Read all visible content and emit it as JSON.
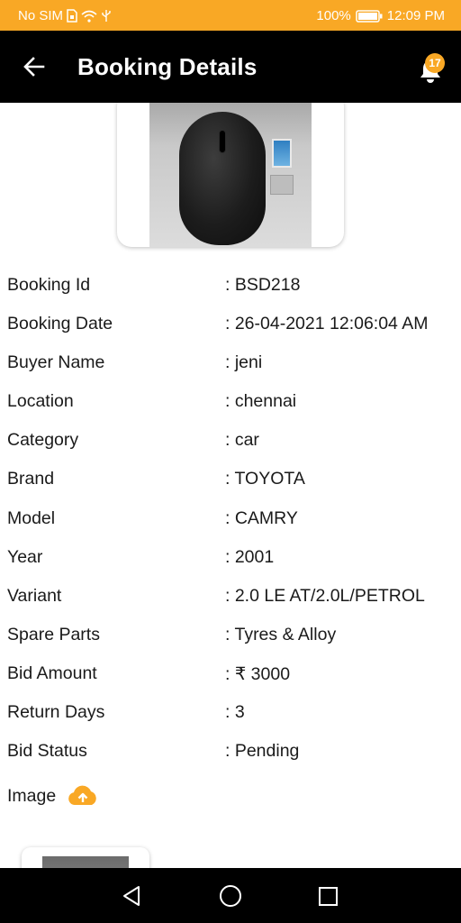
{
  "status_bar": {
    "carrier": "No SIM",
    "battery": "100%",
    "time": "12:09 PM"
  },
  "app_bar": {
    "title": "Booking Details",
    "notification_count": "17"
  },
  "details": [
    {
      "label": "Booking Id",
      "value": ": BSD218"
    },
    {
      "label": "Booking Date",
      "value": ": 26-04-2021 12:06:04 AM"
    },
    {
      "label": "Buyer Name",
      "value": ": jeni"
    },
    {
      "label": "Location",
      "value": ": chennai"
    },
    {
      "label": "Category",
      "value": ": car"
    },
    {
      "label": "Brand",
      "value": ": TOYOTA"
    },
    {
      "label": "Model",
      "value": ": CAMRY"
    },
    {
      "label": "Year",
      "value": ": 2001"
    },
    {
      "label": "Variant",
      "value": ": 2.0 LE AT/2.0L/PETROL"
    },
    {
      "label": "Spare Parts",
      "value": ": Tyres & Alloy"
    },
    {
      "label": "Bid Amount",
      "value": ": ₹ 3000"
    },
    {
      "label": "Return Days",
      "value": ": 3"
    },
    {
      "label": "Bid Status",
      "value": ": Pending"
    }
  ],
  "image_section": {
    "label": "Image",
    "upload_icon": "cloud-upload-icon"
  },
  "icons": {
    "back": "arrow-left-icon",
    "bell": "bell-icon",
    "nav_back": "triangle-back-icon",
    "nav_home": "circle-home-icon",
    "nav_recent": "square-recent-icon"
  },
  "colors": {
    "accent": "#F9A825",
    "app_bar": "#000000",
    "text": "#1a1a1a"
  }
}
